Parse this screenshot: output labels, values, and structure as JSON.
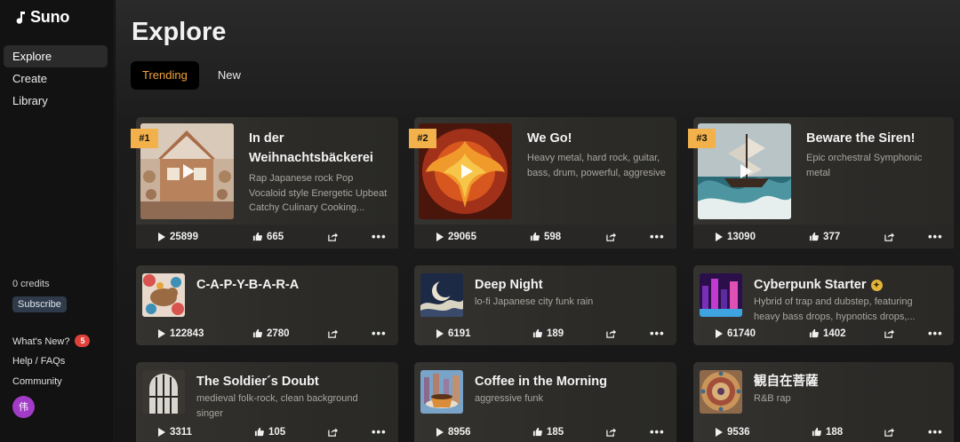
{
  "app": {
    "name": "Suno"
  },
  "sidebar": {
    "items": [
      {
        "label": "Explore",
        "active": true
      },
      {
        "label": "Create",
        "active": false
      },
      {
        "label": "Library",
        "active": false
      }
    ],
    "credits": "0 credits",
    "subscribe": "Subscribe",
    "whats_new": "What's New?",
    "whats_new_badge": "5",
    "help": "Help / FAQs",
    "community": "Community",
    "avatar_initial": "伟"
  },
  "page": {
    "title": "Explore"
  },
  "tabs": [
    {
      "label": "Trending",
      "active": true
    },
    {
      "label": "New",
      "active": false
    }
  ],
  "colors": {
    "accent": "#f2a23a",
    "rank_badge": "#f2b14a",
    "badge_red": "#e0413a",
    "avatar": "#a23bc7"
  },
  "songs": [
    {
      "rank": "#1",
      "title_line1": "In der",
      "title_line2": "Weihnachtsbäckerei",
      "desc": [
        "Rap Japanese rock Pop",
        "Vocaloid style Energetic Upbeat",
        "Catchy Culinary Cooking..."
      ],
      "plays": "25899",
      "likes": "665",
      "icon": "bakery-art"
    },
    {
      "rank": "#2",
      "title_line1": "We Go!",
      "desc": [
        "Heavy metal, hard rock, guitar,",
        "bass, drum, powerful, aggresive"
      ],
      "plays": "29065",
      "likes": "598",
      "icon": "phoenix-art"
    },
    {
      "rank": "#3",
      "title_line1": "Beware the Siren!",
      "desc": [
        "Epic orchestral Symphonic",
        "metal"
      ],
      "plays": "13090",
      "likes": "377",
      "icon": "ship-art"
    },
    {
      "title": "C-A-P-Y-B-A-R-A",
      "desc": [],
      "plays": "122843",
      "likes": "2780",
      "icon": "capybara-art"
    },
    {
      "title": "Deep Night",
      "desc": [
        "lo-fi Japanese city funk rain"
      ],
      "plays": "6191",
      "likes": "189",
      "icon": "moon-art"
    },
    {
      "title": "Cyberpunk Starter",
      "desc": [
        "Hybrid of trap and dubstep, featuring",
        "heavy bass drops, hypnotics drops,..."
      ],
      "plays": "61740",
      "likes": "1402",
      "icon": "cyberpunk-art"
    },
    {
      "title": "The Soldier´s Doubt",
      "desc": [
        "medieval folk-rock, clean background",
        "singer"
      ],
      "plays": "3311",
      "likes": "105",
      "icon": "window-art"
    },
    {
      "title": "Coffee in the Morning",
      "desc": [
        "aggressive funk"
      ],
      "plays": "8956",
      "likes": "185",
      "icon": "coffee-art"
    },
    {
      "title": "観自在菩薩",
      "desc": [
        "R&B rap"
      ],
      "plays": "9536",
      "likes": "188",
      "icon": "mandala-art"
    }
  ]
}
